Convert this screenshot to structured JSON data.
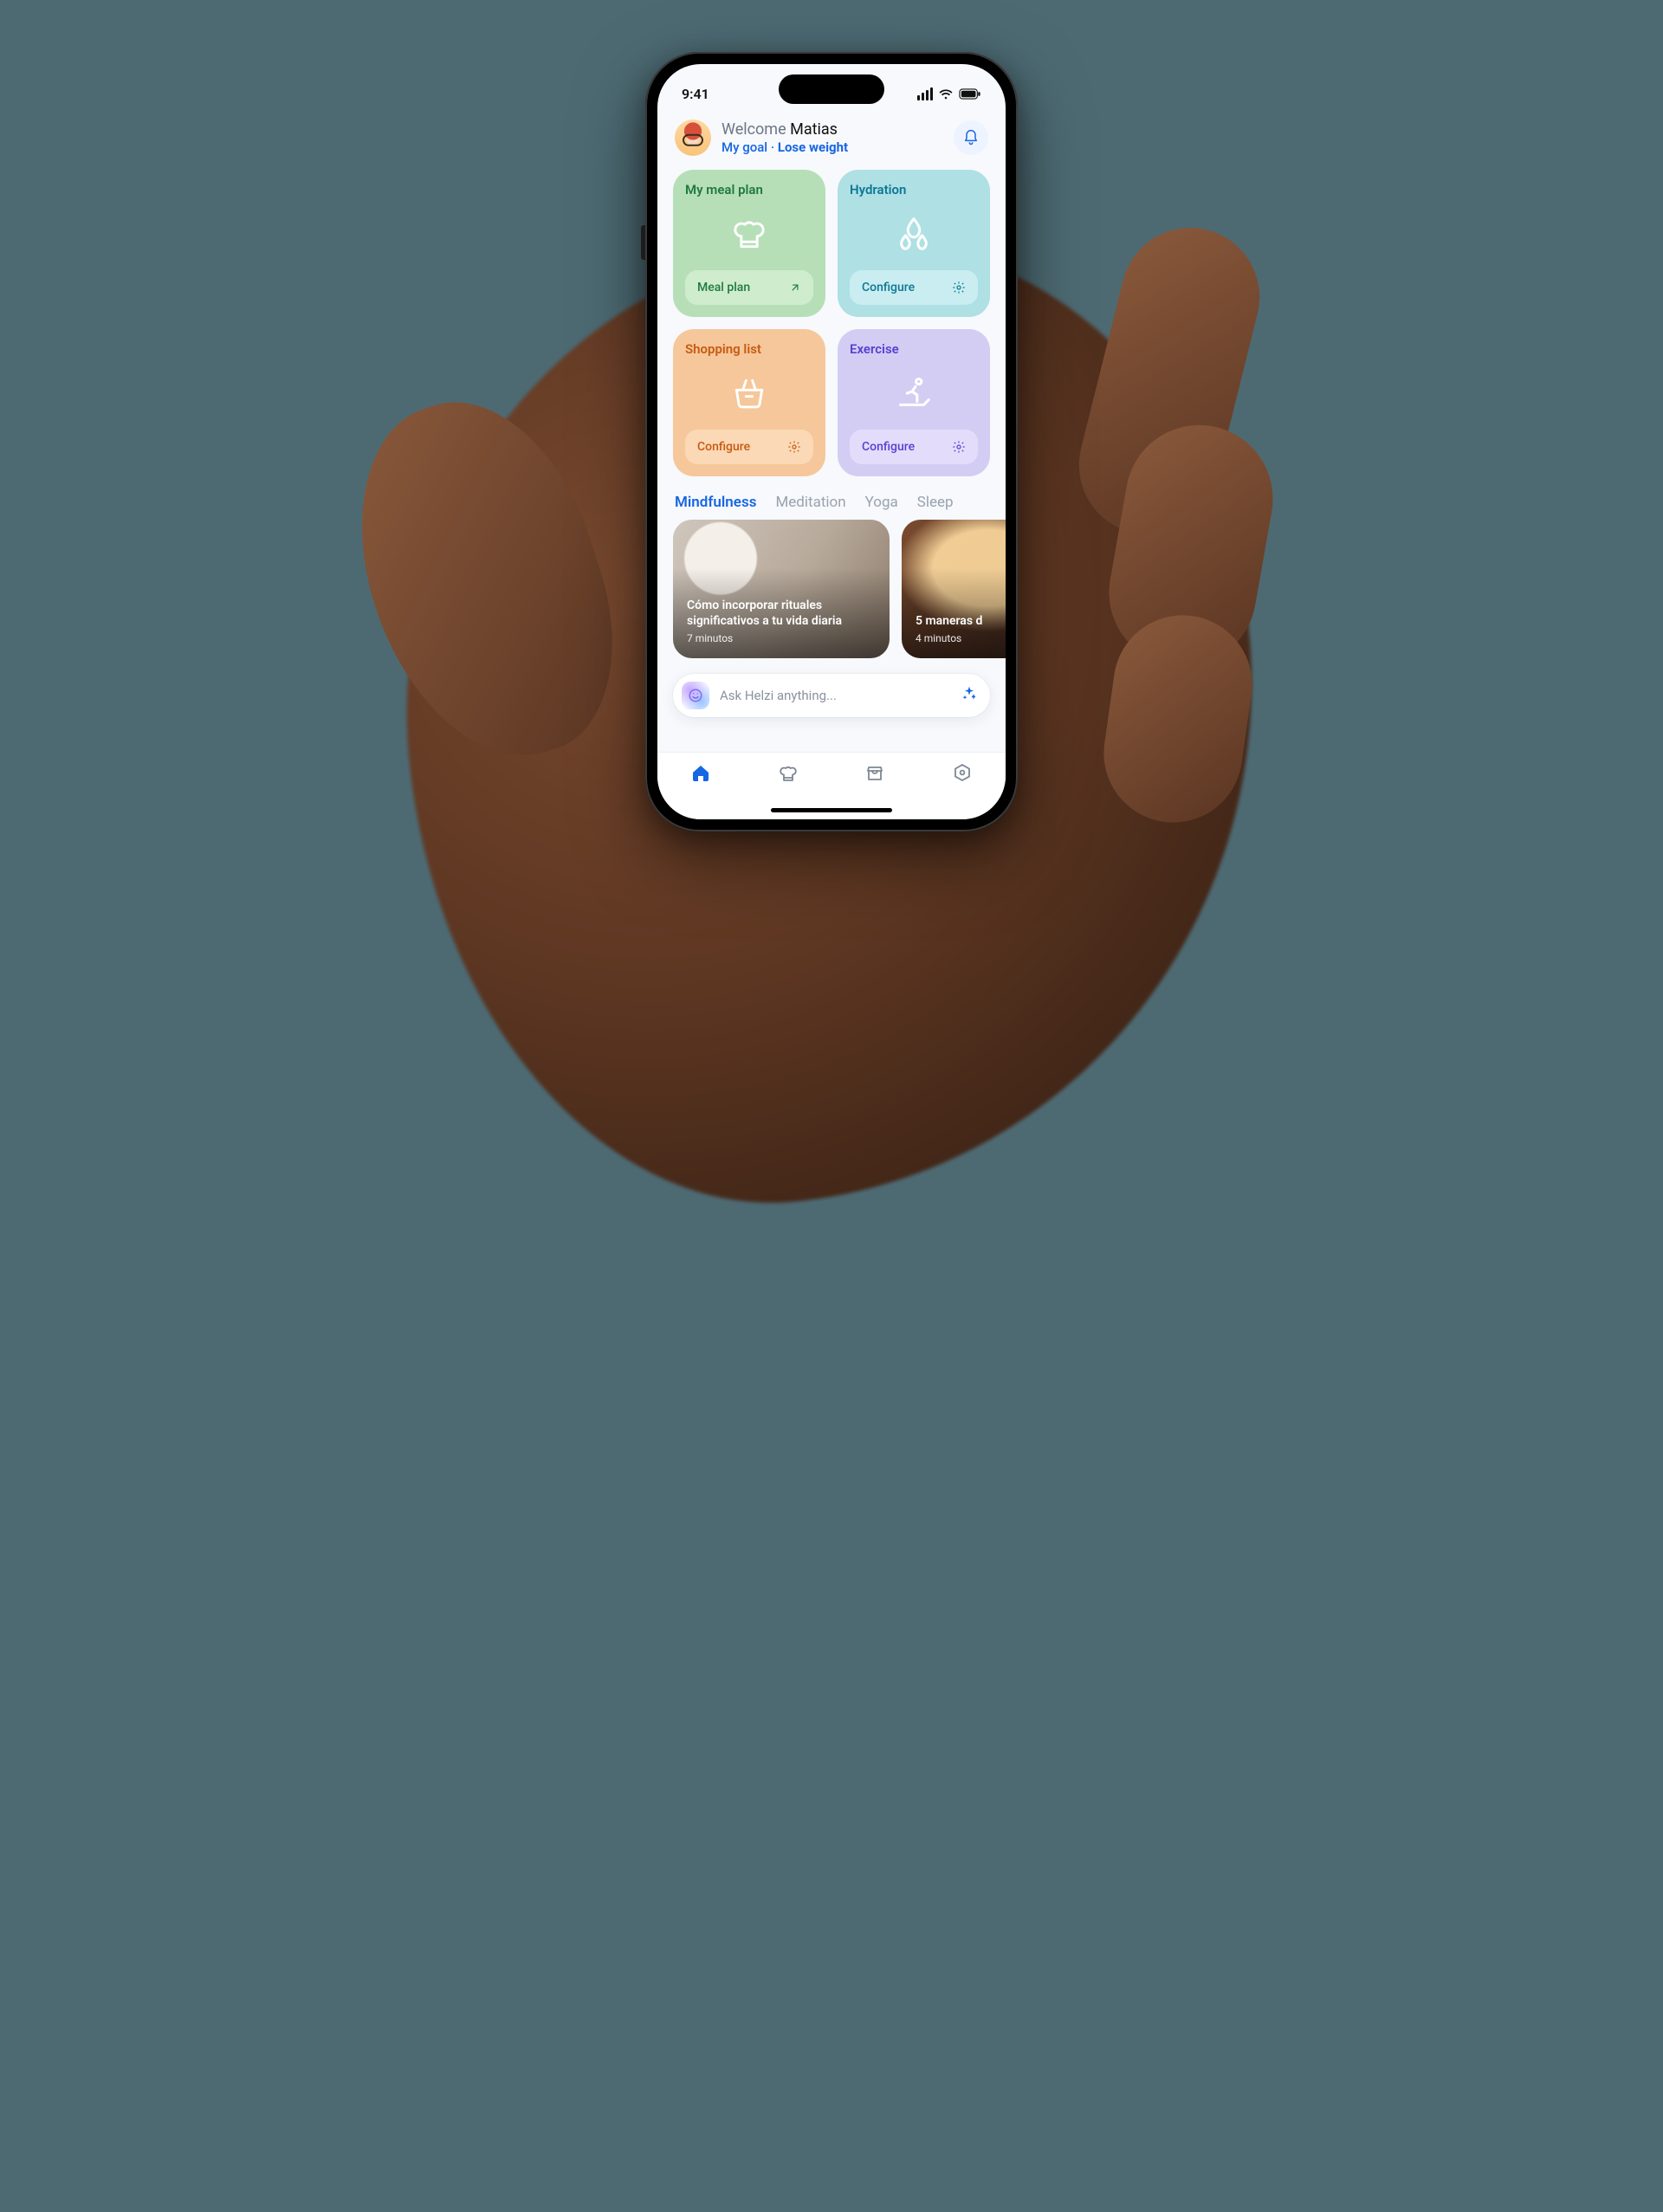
{
  "status": {
    "time": "9:41"
  },
  "header": {
    "welcome_prefix": "Welcome ",
    "user_name": "Matias",
    "goal_label": "My goal",
    "separator": " · ",
    "goal_value": "Lose weight"
  },
  "tiles": {
    "meal": {
      "title": "My meal plan",
      "action": "Meal plan"
    },
    "hydration": {
      "title": "Hydration",
      "action": "Configure"
    },
    "shopping": {
      "title": "Shopping list",
      "action": "Configure"
    },
    "exercise": {
      "title": "Exercise",
      "action": "Configure"
    }
  },
  "tabs": [
    "Mindfulness",
    "Meditation",
    "Yoga",
    "Sleep"
  ],
  "articles": [
    {
      "title": "Cómo incorporar rituales significativos a tu vida diaria",
      "duration": "7 minutos"
    },
    {
      "title": "5 maneras d",
      "duration": "4 minutos"
    }
  ],
  "ask": {
    "placeholder": "Ask Helzi anything..."
  },
  "nav": {
    "items": [
      "home",
      "meals",
      "store",
      "settings"
    ],
    "active": "home"
  },
  "colors": {
    "accent": "#1766e3",
    "meal": "#1f7a3d",
    "hydration": "#0d7796",
    "shopping": "#c85a12",
    "exercise": "#5a3fd1"
  },
  "icons": {
    "bell": "bell-icon",
    "chef_hat": "chef-hat-icon",
    "droplets": "droplets-icon",
    "basket": "basket-icon",
    "treadmill": "treadmill-icon",
    "arrow_open": "arrow-up-right-icon",
    "gear": "gear-icon",
    "sparkle": "sparkle-icon",
    "home": "home-icon",
    "store": "store-icon",
    "settings_hex": "settings-hex-icon",
    "smile": "smile-icon"
  }
}
